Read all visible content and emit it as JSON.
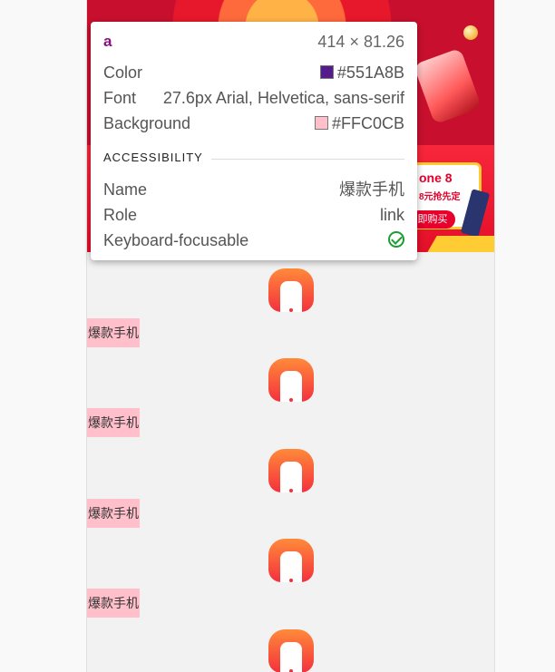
{
  "tooltip": {
    "tag": "a",
    "dimensions": "414 × 81.26",
    "color_label": "Color",
    "color_value": "#551A8B",
    "color_hex": "#551A8B",
    "font_label": "Font",
    "font_value": "27.6px Arial, Helvetica, sans-serif",
    "background_label": "Background",
    "background_value": "#FFC0CB",
    "background_hex": "#FFC0CB",
    "accessibility_header": "ACCESSIBILITY",
    "name_label": "Name",
    "name_value": "爆款手机",
    "role_label": "Role",
    "role_value": "link",
    "focusable_label": "Keyboard-focusable",
    "focusable_icon": "check-circle-icon"
  },
  "promo": {
    "line1": "one 8",
    "line2": "8元抢先定",
    "buy_label": "即购买"
  },
  "nav_items": [
    {
      "label": "爆款手机",
      "icon": "phone-icon"
    },
    {
      "label": "爆款手机",
      "icon": "phone-icon"
    },
    {
      "label": "爆款手机",
      "icon": "phone-icon"
    },
    {
      "label": "爆款手机",
      "icon": "phone-icon"
    },
    {
      "label": "",
      "icon": "phone-icon"
    }
  ]
}
